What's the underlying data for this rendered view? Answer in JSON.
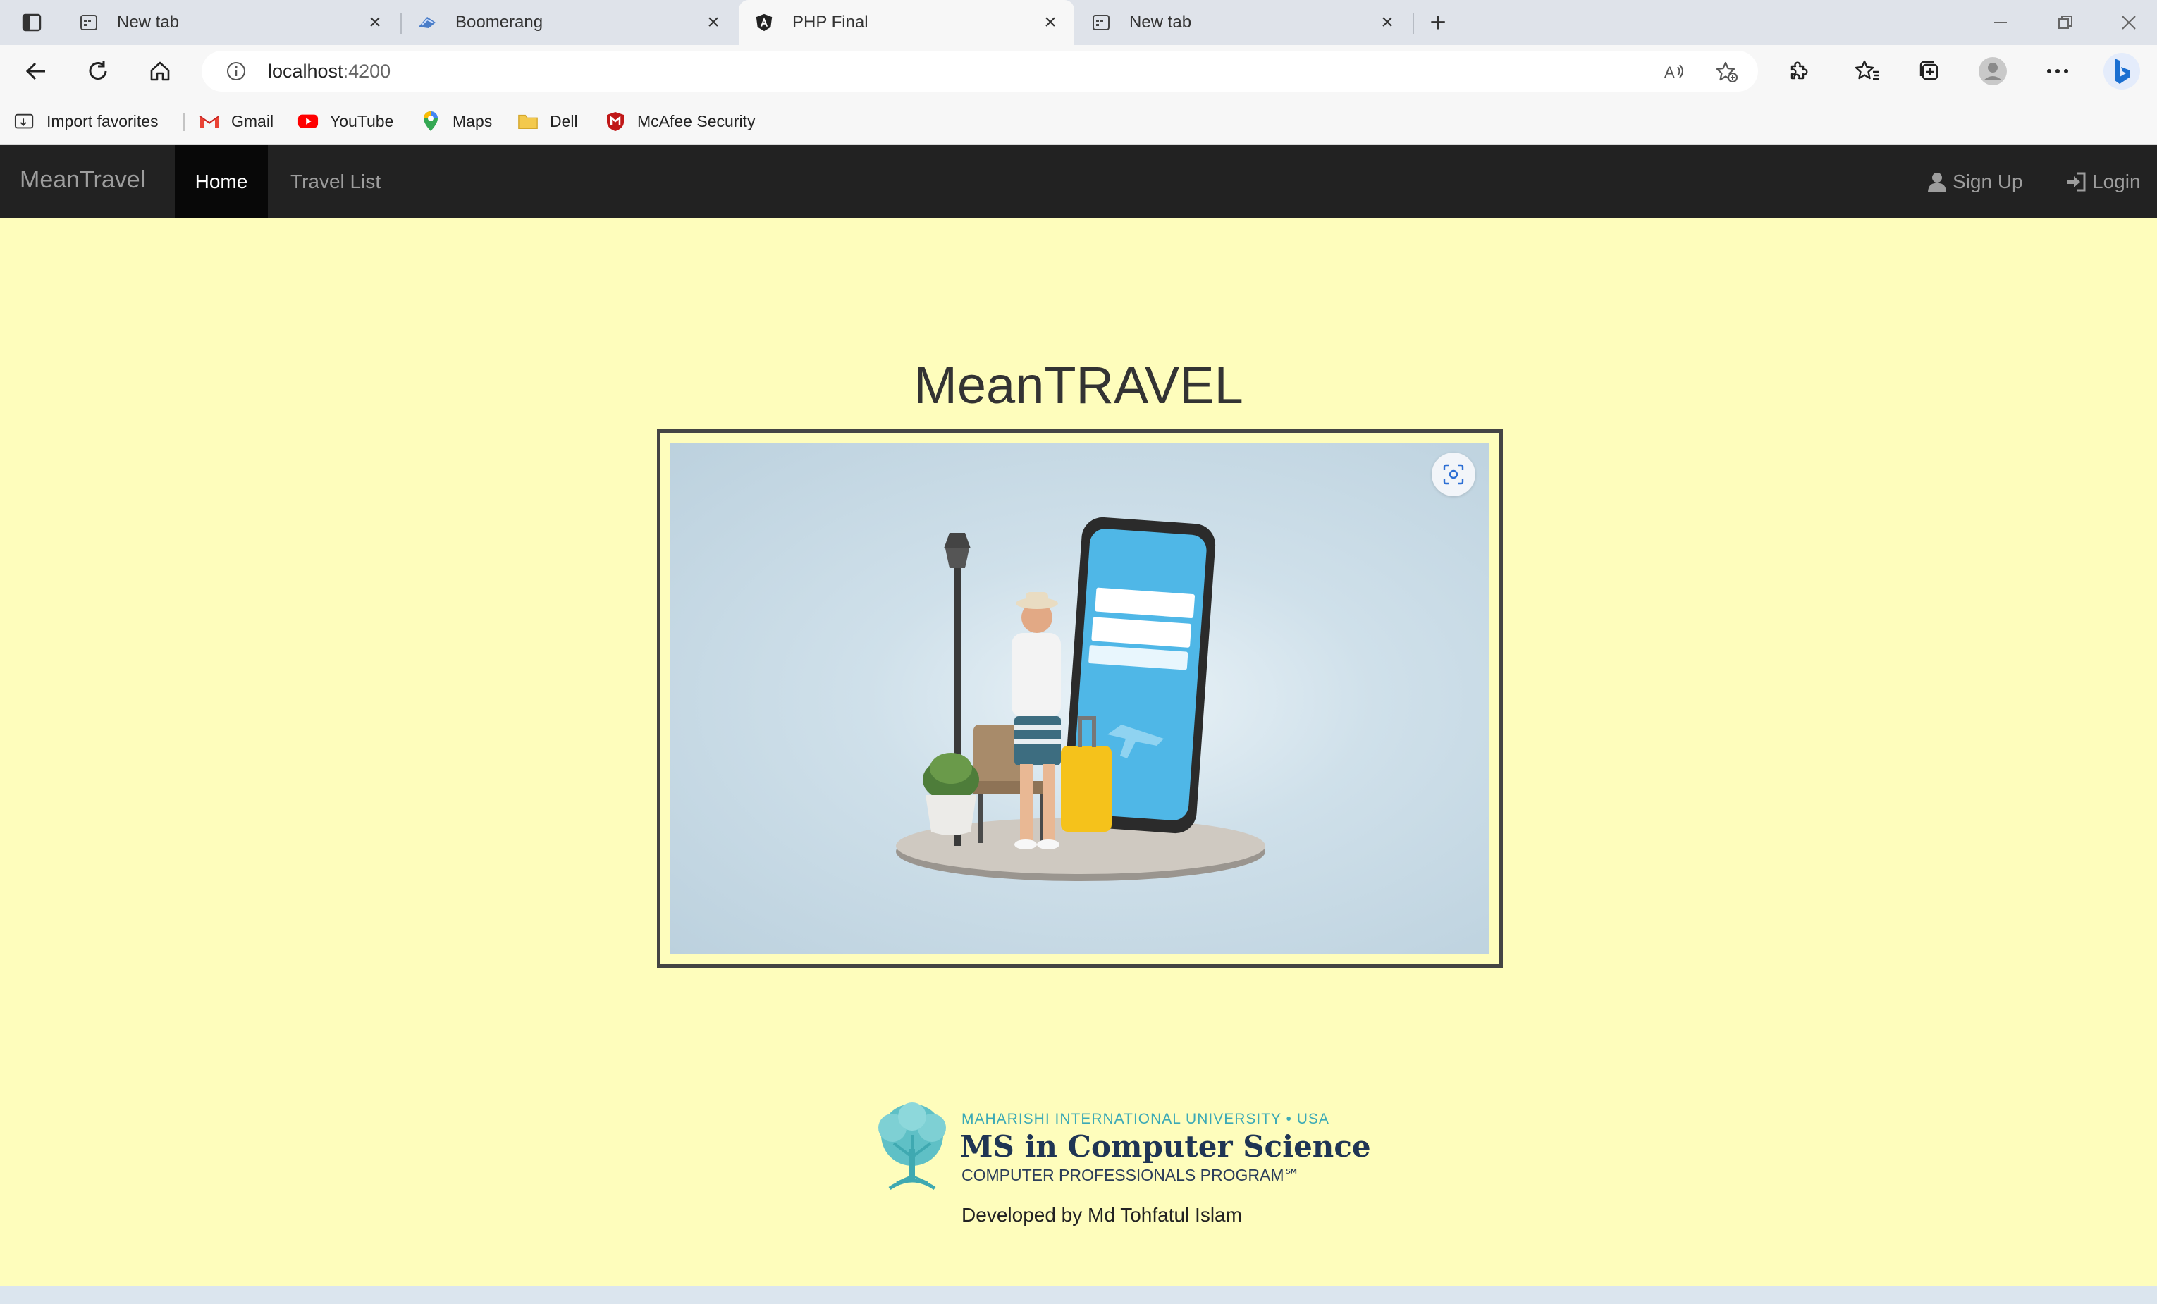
{
  "browser": {
    "tabs": [
      {
        "title": "New tab",
        "active": false
      },
      {
        "title": "Boomerang",
        "active": false
      },
      {
        "title": "PHP Final",
        "active": true
      },
      {
        "title": "New tab",
        "active": false
      }
    ],
    "address": {
      "host": "localhost",
      "port": ":4200"
    },
    "bookmarks": [
      {
        "label": "Import favorites",
        "icon": "import-icon"
      },
      {
        "label": "Gmail",
        "icon": "gmail-icon"
      },
      {
        "label": "YouTube",
        "icon": "youtube-icon"
      },
      {
        "label": "Maps",
        "icon": "maps-icon"
      },
      {
        "label": "Dell",
        "icon": "folder-icon"
      },
      {
        "label": "McAfee Security",
        "icon": "mcafee-icon"
      }
    ]
  },
  "navbar": {
    "brand": "MeanTravel",
    "home": "Home",
    "travel_list": "Travel List",
    "sign_up": "Sign Up",
    "login": "Login"
  },
  "main": {
    "title": "MeanTRAVEL"
  },
  "footer": {
    "logo": {
      "line1": "MAHARISHI INTERNATIONAL UNIVERSITY • USA",
      "line2": "MS in Computer Science",
      "line3": "COMPUTER PROFESSIONALS PROGRAM℠"
    },
    "credit": "Developed by Md Tohfatul Islam"
  },
  "colors": {
    "page_bg": "#fefdbc",
    "navbar_bg": "#222222",
    "navbar_active_bg": "#080808",
    "navbar_text": "#9d9d9d"
  }
}
